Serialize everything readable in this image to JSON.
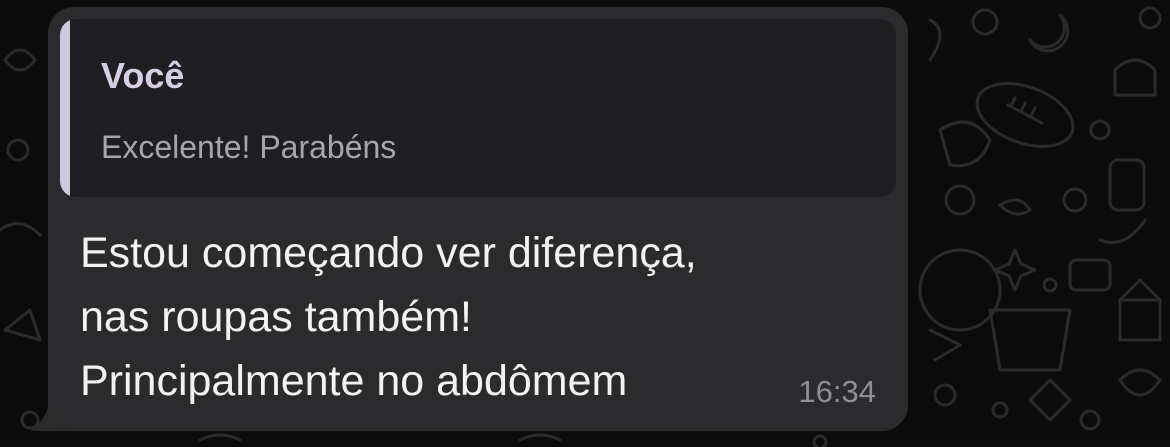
{
  "chat": {
    "reply_quote": {
      "author": "Você",
      "text": "Excelente! Parabéns"
    },
    "message": {
      "lines": [
        "Estou começando ver diferença,",
        "nas roupas também!",
        "Principalmente no abdômem"
      ],
      "time": "16:34"
    }
  },
  "colors": {
    "background": "#0b0b0b",
    "bubble": "#2b2b2d",
    "quote_background": "#1f1f21",
    "quote_accent": "#cfc7e0",
    "message_text": "#f2f2f2",
    "timestamp": "#8e8e93"
  }
}
